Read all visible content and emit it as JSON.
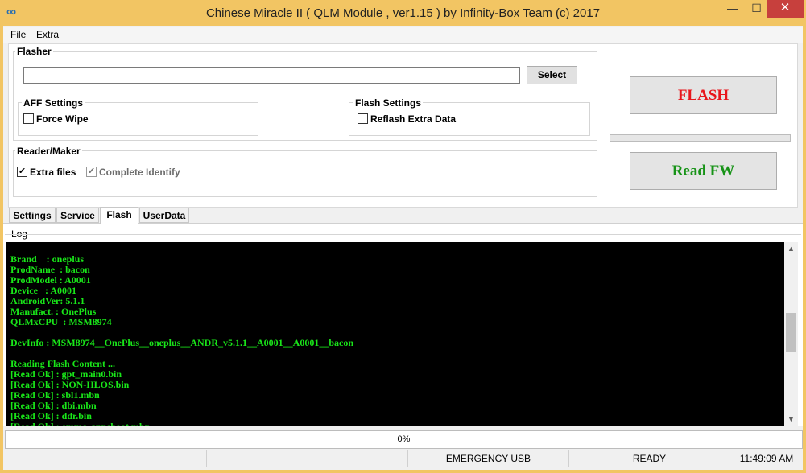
{
  "window": {
    "title": "Chinese Miracle II ( QLM Module , ver1.15  ) by Infinity-Box Team (c) 2017",
    "app_icon": "∞",
    "minimize_glyph": "—",
    "maximize_glyph": "☐",
    "close_glyph": "✕"
  },
  "menu": {
    "items": [
      "File",
      "Extra"
    ]
  },
  "flasher": {
    "label": "Flasher",
    "path_value": "",
    "select_label": "Select"
  },
  "aff_settings": {
    "label": "AFF Settings",
    "force_wipe_label": "Force Wipe",
    "force_wipe_checked": false
  },
  "flash_settings": {
    "label": "Flash Settings",
    "reflash_label": "Reflash Extra Data",
    "reflash_checked": false
  },
  "reader_maker": {
    "label": "Reader/Maker",
    "extra_files_label": "Extra files",
    "extra_files_checked": true,
    "complete_identify_label": "Complete Identify",
    "complete_identify_checked": true,
    "complete_identify_disabled": true
  },
  "buttons": {
    "flash": "FLASH",
    "read_fw": "Read FW"
  },
  "tabs": [
    "Settings",
    "Service",
    "Flash",
    "UserData"
  ],
  "active_tab": "Flash",
  "log": {
    "label": "Log",
    "lines": [
      "Brand    : oneplus",
      "ProdName  : bacon",
      "ProdModel : A0001",
      "Device   : A0001",
      "AndroidVer: 5.1.1",
      "Manufact. : OnePlus",
      "QLMxCPU  : MSM8974",
      "",
      "DevInfo : MSM8974__OnePlus__oneplus__ANDR_v5.1.1__A0001__A0001__bacon",
      "",
      "Reading Flash Content ...",
      "[Read Ok] : gpt_main0.bin",
      "[Read Ok] : NON-HLOS.bin",
      "[Read Ok] : sbl1.mbn",
      "[Read Ok] : dbi.mbn",
      "[Read Ok] : ddr.bin",
      "[Read Ok] : emmc_appsboot.mbn"
    ]
  },
  "progress": {
    "text": "0%",
    "value": 0
  },
  "status": {
    "cell1": "",
    "cell2": "",
    "mode": "EMERGENCY USB",
    "state": "READY",
    "time": "11:49:09 AM"
  },
  "colors": {
    "flash": "#e8161c",
    "read_fw": "#179317",
    "log_text": "#19e619",
    "log_bg": "#000000"
  }
}
